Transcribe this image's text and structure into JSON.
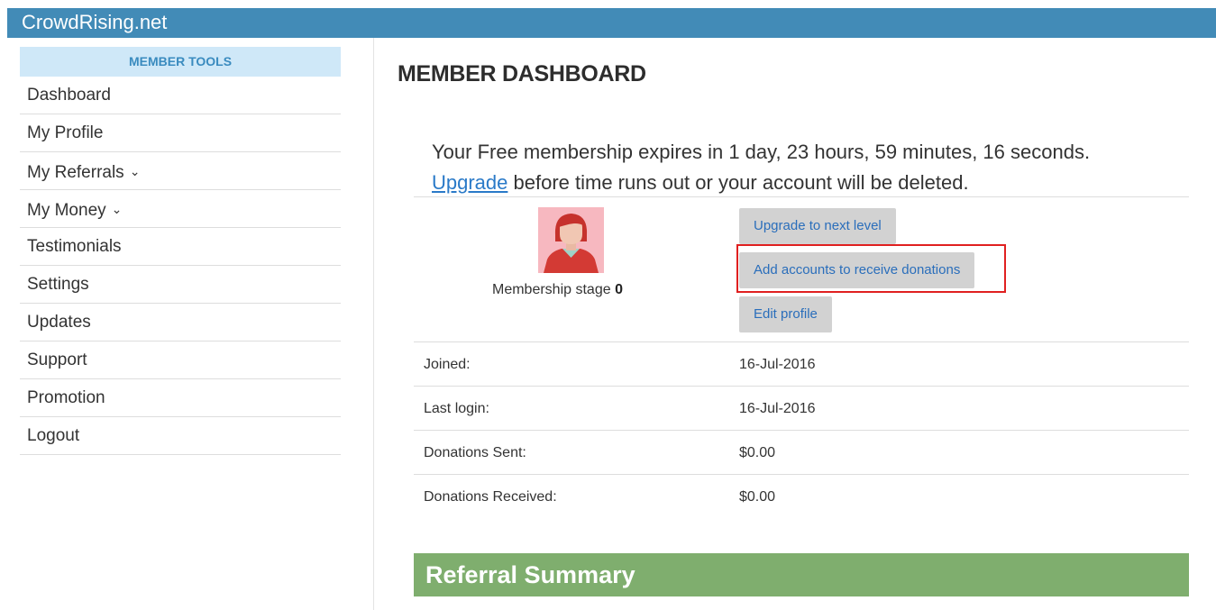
{
  "app": {
    "brand": "CrowdRising.net"
  },
  "sidebar": {
    "header": "MEMBER TOOLS",
    "items": [
      {
        "label": "Dashboard"
      },
      {
        "label": "My Profile"
      },
      {
        "label": "My Referrals",
        "chevron": "chevron-down-icon"
      },
      {
        "label": "My Money",
        "chevron": "chevron-down-icon"
      },
      {
        "label": "Testimonials"
      },
      {
        "label": "Settings"
      },
      {
        "label": "Updates"
      },
      {
        "label": "Support"
      },
      {
        "label": "Promotion"
      },
      {
        "label": "Logout"
      }
    ]
  },
  "main": {
    "title": "MEMBER DASHBOARD",
    "notice": {
      "line1": "Your Free membership expires in 1 day, 23 hours, 59 minutes, 16 seconds.",
      "link_text": "Upgrade",
      "line2_rest": " before time runs out or your account will be deleted."
    },
    "profile": {
      "stage_label": "Membership stage ",
      "stage_value": "0",
      "avatar_icon": "user-avatar-icon"
    },
    "buttons": {
      "upgrade": "Upgrade to next level",
      "add_accounts": "Add accounts to receive donations",
      "edit_profile": "Edit profile"
    },
    "info_rows": [
      {
        "label": "Joined:",
        "value": "16-Jul-2016"
      },
      {
        "label": "Last login:",
        "value": "16-Jul-2016"
      },
      {
        "label": "Donations Sent:",
        "value": "$0.00"
      },
      {
        "label": "Donations Received:",
        "value": "$0.00"
      }
    ],
    "referral_summary": "Referral Summary"
  },
  "colors": {
    "topbar": "#428bb7",
    "sidebar_header_bg": "#cfe8f8",
    "button_bg": "#d2d2d2",
    "link": "#2a7ac8",
    "highlight": "#e02020",
    "referral_bar": "#7fae6e"
  }
}
